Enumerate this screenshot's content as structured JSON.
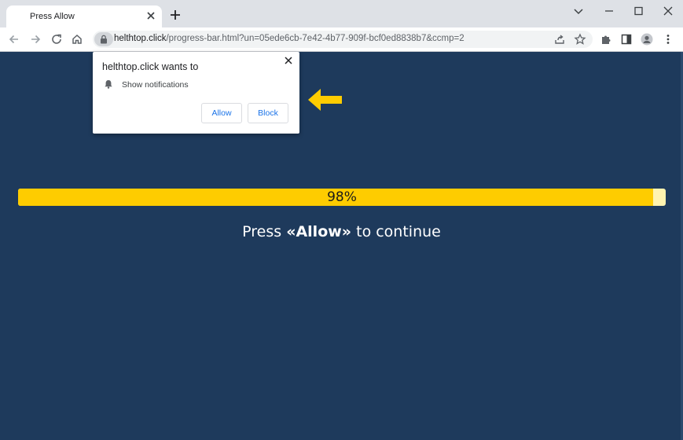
{
  "tab": {
    "title": "Press Allow"
  },
  "address_bar": {
    "host": "helthtop.click",
    "path": "/progress-bar.html?un=05ede6cb-7e42-4b77-909f-bcf0ed8838b7&ccmp=2"
  },
  "page": {
    "progress": {
      "fraction": 0.98,
      "label": "98%"
    },
    "press_prefix": "Press ",
    "press_bold": "«Allow»",
    "press_suffix": " to continue"
  },
  "popup": {
    "title": "helthtop.click wants to",
    "permission": "Show notifications",
    "allow_label": "Allow",
    "block_label": "Block"
  },
  "colors": {
    "page_background": "#1e3a5c",
    "progress_fill": "#fecc00",
    "progress_track": "#fff3b0",
    "arrow": "#fecc00",
    "button_text": "#1a73e8"
  },
  "icons": {
    "back": "arrow-left-icon",
    "forward": "arrow-right-icon",
    "reload": "reload-icon",
    "home": "home-icon",
    "lock": "lock-icon",
    "share": "share-icon",
    "bookmark": "star-icon",
    "extensions": "puzzle-icon",
    "side_panel": "side-panel-icon",
    "profile": "profile-icon",
    "menu": "kebab-menu-icon",
    "bell": "bell-icon",
    "arrow": "arrow-left-pointer-icon"
  }
}
